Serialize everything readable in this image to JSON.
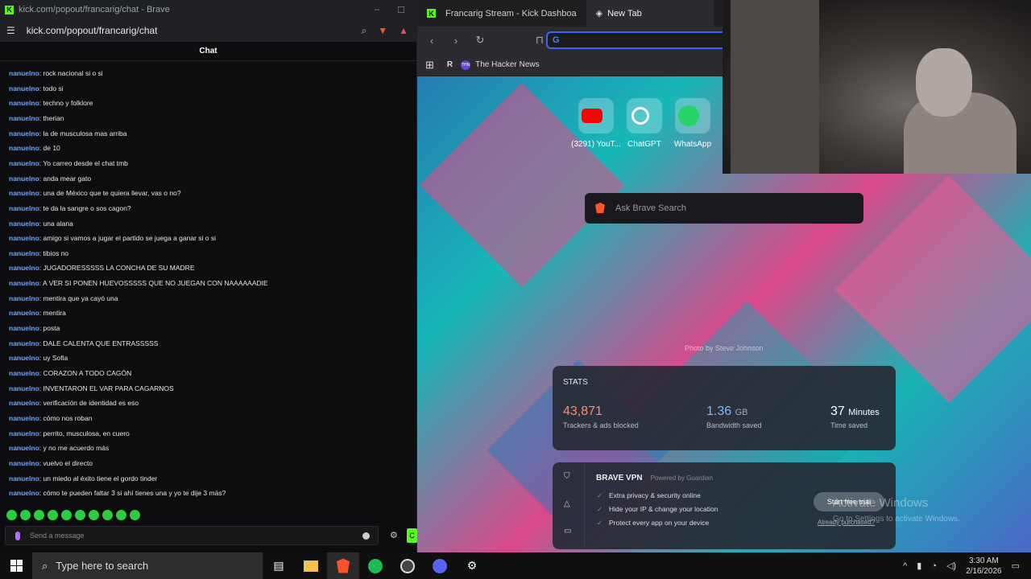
{
  "left_window": {
    "title": "kick.com/popout/francarig/chat - Brave",
    "url": "kick.com/popout/francarig/chat",
    "chat_header": "Chat",
    "messages": [
      {
        "user": "nanuelno",
        "text": ": rock nacional si o si"
      },
      {
        "user": "nanuelno",
        "text": ": todo si"
      },
      {
        "user": "nanuelno",
        "text": ": techno y folklore"
      },
      {
        "user": "nanuelno",
        "text": ": therian"
      },
      {
        "user": "nanuelno",
        "text": ": la de musculosa mas arriba"
      },
      {
        "user": "nanuelno",
        "text": ": de 10"
      },
      {
        "user": "nanuelno",
        "text": ": Yo carreo desde el chat tmb"
      },
      {
        "user": "nanuelno",
        "text": ": anda mear gato"
      },
      {
        "user": "nanuelno",
        "text": ": una de México que te quiera llevar, vas o no?"
      },
      {
        "user": "nanuelno",
        "text": ": te da la sangre o sos cagon?"
      },
      {
        "user": "nanuelno",
        "text": ": una alana"
      },
      {
        "user": "nanuelno",
        "text": ": amigo si vamos a jugar el partido se juega a ganar si o si"
      },
      {
        "user": "nanuelno",
        "text": ": tibios no"
      },
      {
        "user": "nanuelno",
        "text": ": JUGADORESSSSS LA CONCHA DE SU MADRE"
      },
      {
        "user": "nanuelno",
        "text": ": A VER SI PONEN HUEVOSSSSS QUE NO JUEGAN CON NAAAAAADIE"
      },
      {
        "user": "nanuelno",
        "text": ": mentira que ya cayó una"
      },
      {
        "user": "nanuelno",
        "text": ": mentira"
      },
      {
        "user": "nanuelno",
        "text": ": posta"
      },
      {
        "user": "nanuelno",
        "text": ": DALE CALENTA QUE ENTRASSSSS"
      },
      {
        "user": "nanuelno",
        "text": ": uy Sofia"
      },
      {
        "user": "nanuelno",
        "text": ": CORAZON A TODO CAGÓN"
      },
      {
        "user": "nanuelno",
        "text": ": INVENTARON EL VAR PARA CAGARNOS"
      },
      {
        "user": "nanuelno",
        "text": ": verificación de identidad es eso"
      },
      {
        "user": "nanuelno",
        "text": ": cómo nos roban"
      },
      {
        "user": "nanuelno",
        "text": ": perrito, musculosa, en cuero"
      },
      {
        "user": "nanuelno",
        "text": ": y no me acuerdo más"
      },
      {
        "user": "nanuelno",
        "text": ": vuelvo el directo"
      },
      {
        "user": "nanuelno",
        "text": ": un miedo al éxito tiene el gordo tinder"
      },
      {
        "user": "nanuelno",
        "text": ": cómo te pueden faltar 3 si ahí tienes una y yo te dije 3 más?"
      }
    ],
    "input_placeholder": "Send a message",
    "send_label": "C"
  },
  "right_window": {
    "tabs": [
      {
        "label": "Francarig Stream - Kick Dashboa"
      },
      {
        "label": "New Tab"
      }
    ],
    "bookmarks": [
      {
        "label": "The Hacker News",
        "badge": "THN"
      }
    ],
    "tiles": [
      {
        "label": "(3291) YouT..."
      },
      {
        "label": "ChatGPT"
      },
      {
        "label": "WhatsApp"
      }
    ],
    "search_placeholder": "Ask Brave Search",
    "photo_credit": "Photo by Steve Johnson",
    "stats": {
      "heading": "STATS",
      "trackers_value": "43,871",
      "trackers_label": "Trackers & ads blocked",
      "bandwidth_value": "1.36",
      "bandwidth_unit": "GB",
      "bandwidth_label": "Bandwidth saved",
      "time_value": "37",
      "time_unit": "Minutes",
      "time_label": "Time saved"
    },
    "vpn": {
      "title": "BRAVE VPN",
      "powered": "Powered by Guardian",
      "features": [
        "Extra privacy & security online",
        "Hide your IP & change your location",
        "Protect every app on your device"
      ],
      "cta": "Start free trial",
      "already": "Already purchased?"
    }
  },
  "watermark": {
    "line1": "Activate Windows",
    "line2": "Go to Settings to activate Windows."
  },
  "taskbar": {
    "search_placeholder": "Type here to search",
    "time": "3:30 AM",
    "date": "2/16/2026"
  },
  "colors": {
    "kick_green": "#53fc18",
    "username": "#6ea6ff",
    "brave_orange": "#fb542b",
    "trackers": "#ff8a6a",
    "bandwidth": "#7fb6ff"
  }
}
